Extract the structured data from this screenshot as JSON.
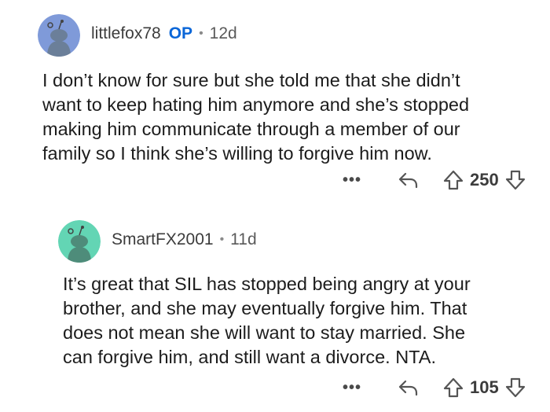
{
  "comment1": {
    "username": "littlefox78",
    "op_badge": "OP",
    "separator": "•",
    "age": "12d",
    "body": "I don’t know for sure but she told me that she didn’t\nwant to keep hating him anymore and she’s stopped\nmaking him communicate through a member of our\nfamily so I think she’s willing to forgive him now.",
    "more": "•••",
    "score": "250",
    "avatar_color": "#7f9ad9"
  },
  "comment2": {
    "username": "SmartFX2001",
    "separator": "•",
    "age": "11d",
    "body": "It’s great that SIL has stopped being angry at your\nbrother, and she may eventually forgive him.  That\ndoes not mean she will want to stay married.   She\ncan forgive him, and still want a divorce.  NTA.",
    "more": "•••",
    "score": "105",
    "avatar_color": "#63d5b4"
  },
  "icons": {
    "reply": "reply-icon",
    "upvote": "upvote-icon",
    "downvote": "downvote-icon",
    "more": "more-options-icon",
    "avatar": "snoo-avatar-icon"
  }
}
